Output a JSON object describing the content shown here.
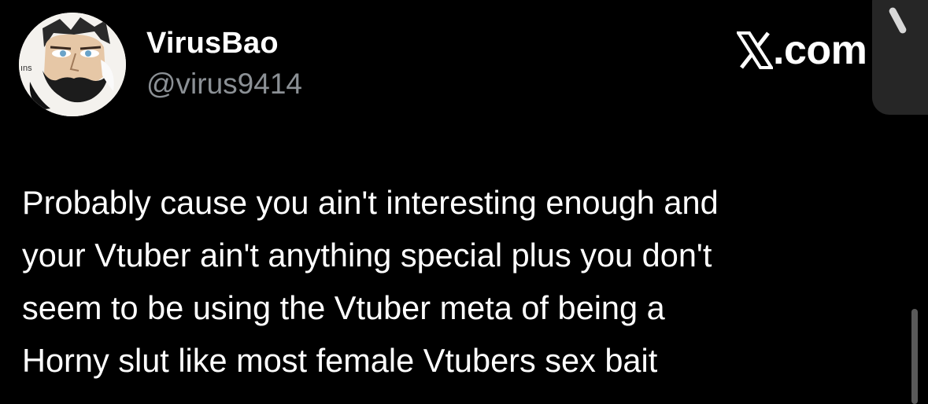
{
  "tweet": {
    "author": {
      "display_name": "VirusBao",
      "handle": "@virus9414",
      "avatar_icon": "avatar-cartoon-bearded-man"
    },
    "brand": {
      "text": ".com",
      "icon": "x-logo-icon"
    },
    "body_lines": [
      "Probably cause you ain't interesting enough and",
      "your Vtuber ain't anything special plus you don't",
      "seem to be using the Vtuber meta of being a",
      "Horny slut like most female Vtubers sex bait"
    ]
  },
  "colors": {
    "background": "#000000",
    "text_primary": "#ffffff",
    "text_secondary": "#8b9095"
  }
}
